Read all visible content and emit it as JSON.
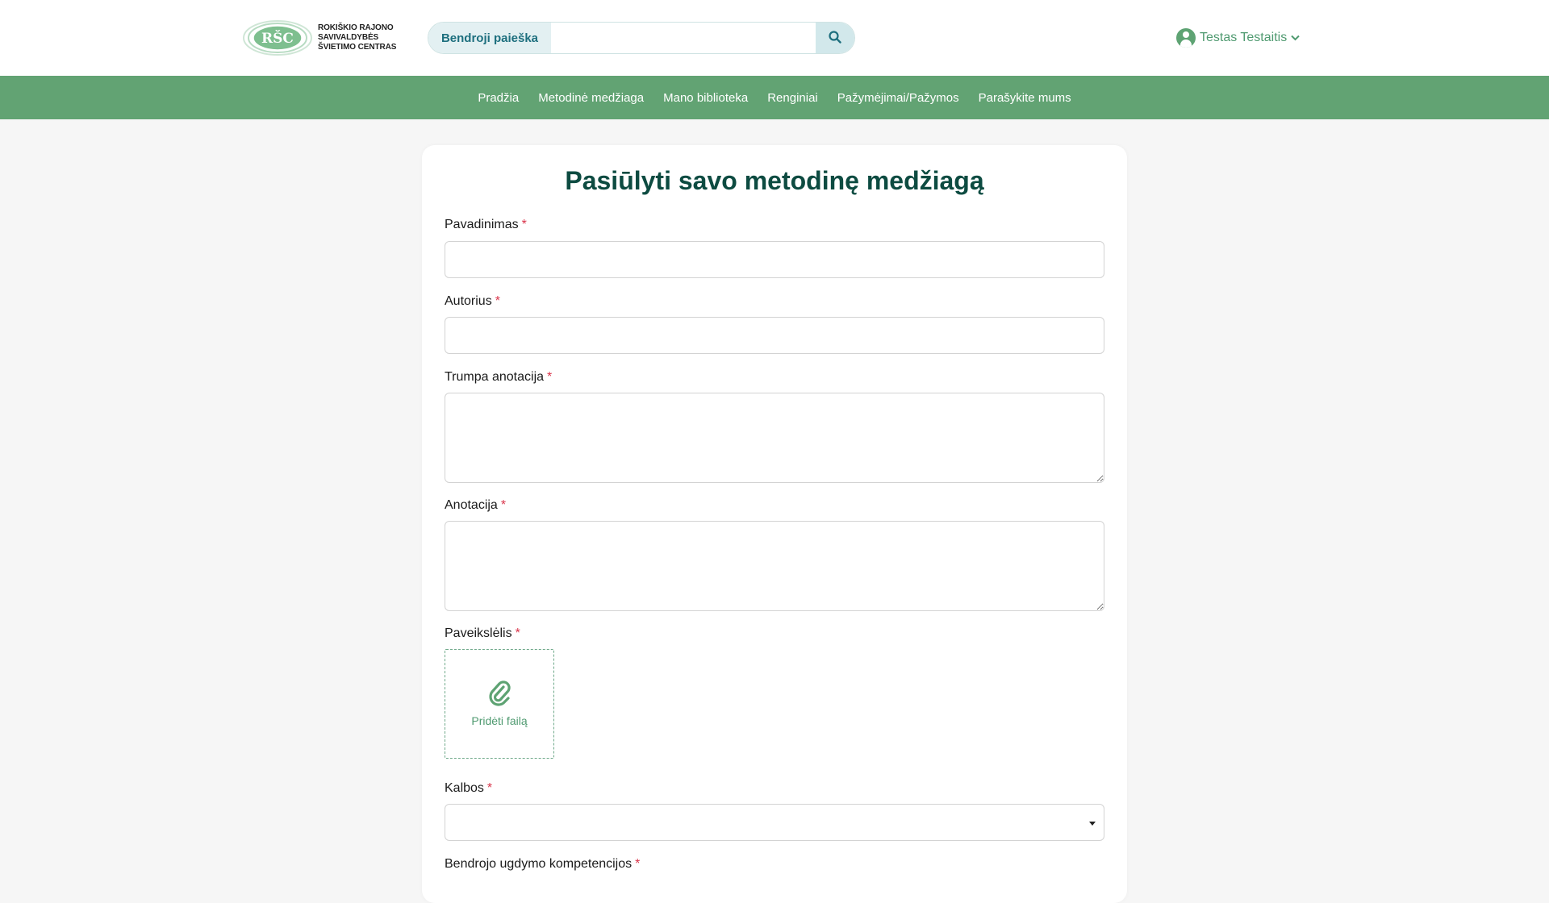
{
  "header": {
    "logo": {
      "badge_text": "RŠC",
      "lines": [
        "ROKIŠKIO RAJONO",
        "SAVIVALDYBĖS",
        "ŠVIETIMO CENTRAS"
      ]
    },
    "search": {
      "label": "Bendroji paieška",
      "value": "",
      "placeholder": ""
    },
    "user": {
      "name": "Testas Testaitis"
    }
  },
  "nav": {
    "items": [
      {
        "label": "Pradžia"
      },
      {
        "label": "Metodinė medžiaga"
      },
      {
        "label": "Mano biblioteka"
      },
      {
        "label": "Renginiai"
      },
      {
        "label": "Pažymėjimai/Pažymos"
      },
      {
        "label": "Parašykite mums"
      }
    ]
  },
  "form": {
    "title": "Pasiūlyti savo metodinę medžiagą",
    "required_mark": "*",
    "fields": {
      "pavadinimas": {
        "label": "Pavadinimas",
        "value": ""
      },
      "autorius": {
        "label": "Autorius",
        "value": ""
      },
      "trumpa_anotacija": {
        "label": "Trumpa anotacija",
        "value": ""
      },
      "anotacija": {
        "label": "Anotacija",
        "value": ""
      },
      "paveikslelis": {
        "label": "Paveikslėlis",
        "button": "Pridėti failą"
      },
      "kalbos": {
        "label": "Kalbos",
        "value": ""
      },
      "kompetencijos": {
        "label": "Bendrojo ugdymo kompetencijos"
      }
    }
  },
  "colors": {
    "brand_green": "#62a373",
    "title_teal": "#0d4b41",
    "required_red": "#d9344a",
    "search_accent": "#1d6f7e"
  },
  "icons": {
    "search": "search-icon",
    "user": "user-icon",
    "chevron": "chevron-down-icon",
    "attach": "paperclip-icon"
  }
}
